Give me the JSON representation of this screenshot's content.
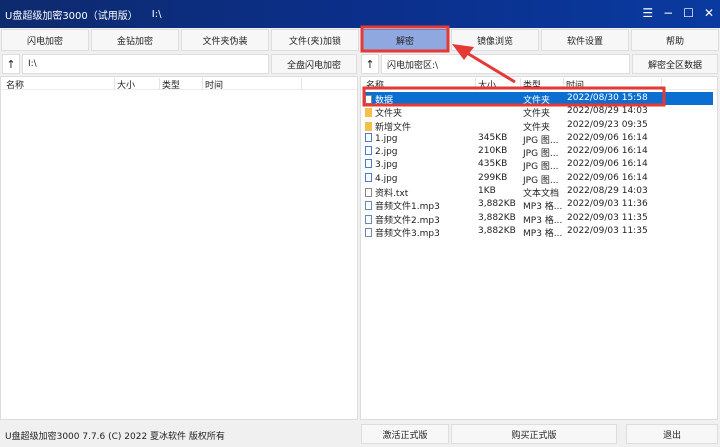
{
  "title": {
    "app": "U盘超级加密3000（试用版）",
    "path": "I:\\"
  },
  "window_controls": [
    "☰",
    "−",
    "☐",
    "✕"
  ],
  "toolbar": [
    "闪电加密",
    "金钻加密",
    "文件夹伪装",
    "文件(夹)加锁",
    "解密",
    "镜像浏览",
    "软件设置",
    "帮助"
  ],
  "left": {
    "up": "↑",
    "path": "I:\\",
    "button": "全盘闪电加密",
    "columns": [
      "名称",
      "大小",
      "类型",
      "时间"
    ]
  },
  "right": {
    "up": "↑",
    "path": "闪电加密区:\\",
    "button": "解密全区数据",
    "columns": [
      "名称",
      "大小",
      "类型",
      "时间"
    ],
    "rows": [
      {
        "icon": "folder-gray",
        "name": "数据",
        "size": "",
        "type": "文件夹",
        "time": "2022/08/30 15:58",
        "selected": true
      },
      {
        "icon": "folder",
        "name": "文件夹",
        "size": "",
        "type": "文件夹",
        "time": "2022/08/29 14:03"
      },
      {
        "icon": "folder",
        "name": "新增文件",
        "size": "",
        "type": "文件夹",
        "time": "2022/09/23 09:35"
      },
      {
        "icon": "img",
        "name": "1.jpg",
        "size": "345KB",
        "type": "JPG 图...",
        "time": "2022/09/06 16:14"
      },
      {
        "icon": "img",
        "name": "2.jpg",
        "size": "210KB",
        "type": "JPG 图...",
        "time": "2022/09/06 16:14"
      },
      {
        "icon": "img",
        "name": "3.jpg",
        "size": "435KB",
        "type": "JPG 图...",
        "time": "2022/09/06 16:14"
      },
      {
        "icon": "img",
        "name": "4.jpg",
        "size": "299KB",
        "type": "JPG 图...",
        "time": "2022/09/06 16:14"
      },
      {
        "icon": "file",
        "name": "资料.txt",
        "size": "1KB",
        "type": "文本文档",
        "time": "2022/08/29 14:03"
      },
      {
        "icon": "aud",
        "name": "音频文件1.mp3",
        "size": "3,882KB",
        "type": "MP3 格...",
        "time": "2022/09/03 11:36"
      },
      {
        "icon": "aud",
        "name": "音频文件2.mp3",
        "size": "3,882KB",
        "type": "MP3 格...",
        "time": "2022/09/03 11:35"
      },
      {
        "icon": "aud",
        "name": "音频文件3.mp3",
        "size": "3,882KB",
        "type": "MP3 格...",
        "time": "2022/09/03 11:35"
      }
    ]
  },
  "status": {
    "text": "U盘超级加密3000 7.7.6 (C) 2022 夏冰软件 版权所有",
    "activate": "激活正式版",
    "buy": "购买正式版",
    "exit": "退出"
  },
  "colors": {
    "title": "#0b2f8a",
    "selected": "#0a6fd0",
    "annotation": "#e53935"
  }
}
